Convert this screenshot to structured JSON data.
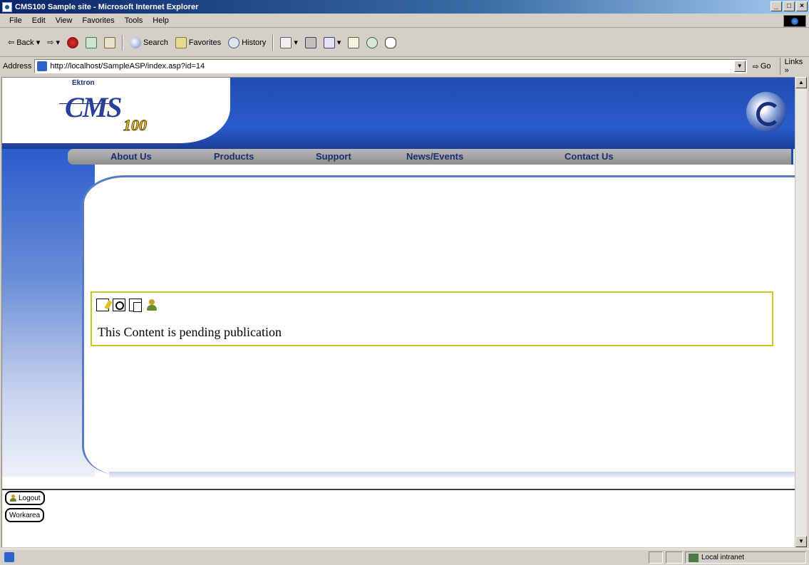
{
  "window": {
    "title": "CMS100 Sample site - Microsoft Internet Explorer",
    "buttons": [
      "_",
      "□",
      "×"
    ]
  },
  "menu": [
    "File",
    "Edit",
    "View",
    "Favorites",
    "Tools",
    "Help"
  ],
  "toolbar": {
    "back": "Back",
    "search": "Search",
    "favorites": "Favorites",
    "history": "History"
  },
  "address": {
    "label": "Address",
    "url": "http://localhost/SampleASP/index.asp?id=14",
    "go": "Go",
    "links": "Links"
  },
  "site": {
    "logo_brand": "Ektron",
    "logo_text": "CMS",
    "logo_num": "100",
    "nav": [
      "About Us",
      "Products",
      "Support",
      "News/Events",
      "Contact Us"
    ]
  },
  "content": {
    "message": "This Content is pending publication"
  },
  "footer": {
    "logout": "Logout",
    "workarea": "Workarea"
  },
  "status": {
    "zone": "Local intranet"
  }
}
